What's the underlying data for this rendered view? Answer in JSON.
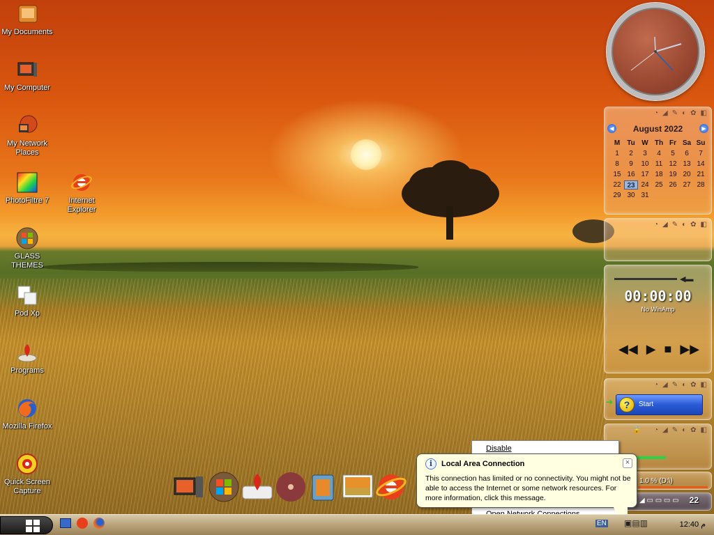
{
  "desktop": {
    "icons": [
      {
        "label": "My Documents",
        "icon": "folder-documents-icon"
      },
      {
        "label": "My Computer",
        "icon": "computer-icon"
      },
      {
        "label": "My Network Places",
        "icon": "network-icon"
      },
      {
        "label": "PhotoFiltre 7",
        "icon": "photofiltre-icon"
      },
      {
        "label": "Internet Explorer",
        "icon": "internet-explorer-icon"
      },
      {
        "label": "GLASS THEMES",
        "icon": "windows-logo-icon"
      },
      {
        "label": "Pod Xp",
        "icon": "pod-xp-icon"
      },
      {
        "label": "Programs",
        "icon": "programs-icon"
      },
      {
        "label": "Mozilla Firefox",
        "icon": "firefox-icon"
      },
      {
        "label": "Quick Screen Capture",
        "icon": "screen-capture-icon"
      }
    ]
  },
  "calendar": {
    "month_label": "August 2022",
    "weekdays": [
      "M",
      "Tu",
      "W",
      "Th",
      "Fr",
      "Sa",
      "Su"
    ],
    "days": [
      "1",
      "2",
      "3",
      "4",
      "5",
      "6",
      "7",
      "8",
      "9",
      "10",
      "11",
      "12",
      "13",
      "14",
      "15",
      "16",
      "17",
      "18",
      "19",
      "20",
      "21",
      "22",
      "23",
      "24",
      "25",
      "26",
      "27",
      "28",
      "29",
      "30",
      "31"
    ],
    "today": "23"
  },
  "player": {
    "time": "00:00:00",
    "status": "No WinAmp"
  },
  "start_gadget": {
    "label": "Start"
  },
  "drive_gadget": {
    "label": "1.0 % (D:\\)",
    "date": "22"
  },
  "context_menu": {
    "items": [
      "Disable",
      "Open Network Connections"
    ]
  },
  "balloon": {
    "title": "Local Area Connection",
    "body": "This connection has limited or no connectivity. You might not be able to access the Internet or some network resources. For more information, click this message."
  },
  "taskbar": {
    "language": "EN",
    "clock": "12:40 م"
  },
  "colors": {
    "sky_top": "#c2400c",
    "sky_horizon": "#f7b341",
    "wheat": "#b7862a",
    "balloon_bg": "#ffffe1"
  }
}
